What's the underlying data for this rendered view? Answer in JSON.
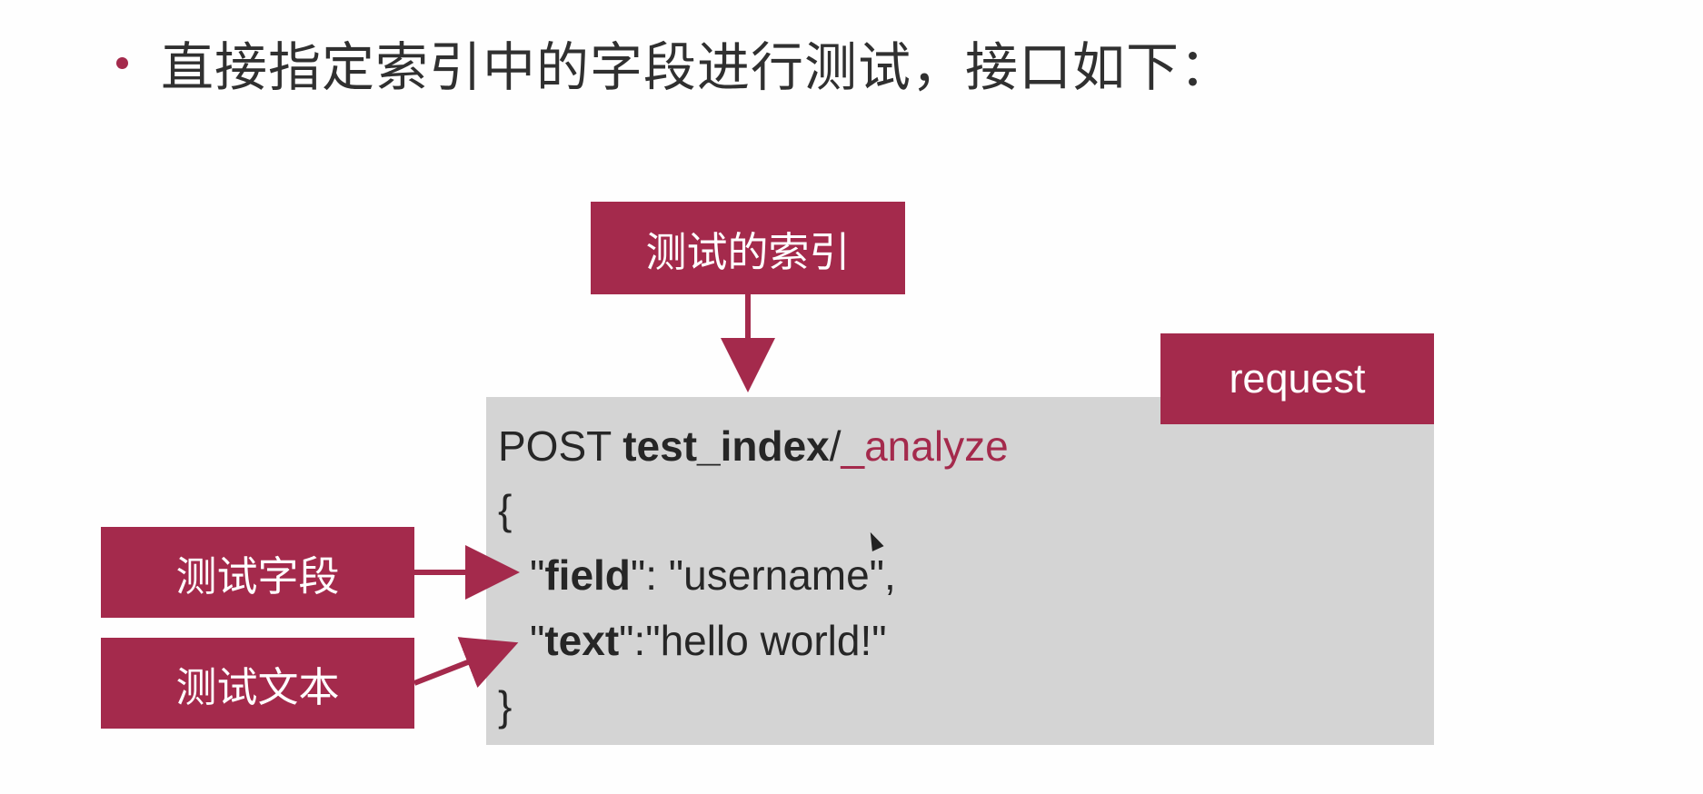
{
  "heading": {
    "text": "直接指定索引中的字段进行测试，接口如下："
  },
  "labels": {
    "index": "测试的索引",
    "request": "request",
    "field": "测试字段",
    "text": "测试文本"
  },
  "code": {
    "method": "POST ",
    "index_name": "test_index",
    "slash": "/",
    "endpoint": "_analyze",
    "open_brace": "{",
    "field_q1": "\"",
    "field_key": "field",
    "field_rest": "\": \"username\",",
    "text_q1": "\"",
    "text_key": "text",
    "text_rest": "\":\"hello world!\"",
    "close_brace": "}"
  },
  "colors": {
    "accent": "#a42a4c",
    "code_bg": "#d4d4d4",
    "text": "#262626"
  },
  "icons": {
    "bullet": "bullet-dot-icon",
    "cursor": "mouse-cursor-icon"
  }
}
